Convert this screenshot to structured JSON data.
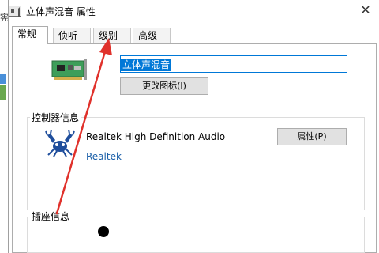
{
  "background": {
    "partial_char": "宪"
  },
  "window": {
    "title": "立体声混音 属性",
    "close_glyph": "✕"
  },
  "tabs": [
    {
      "label": "常规",
      "active": true
    },
    {
      "label": "侦听",
      "active": false
    },
    {
      "label": "级别",
      "active": false
    },
    {
      "label": "高级",
      "active": false
    }
  ],
  "device": {
    "name_value": "立体声混音",
    "change_icon_label": "更改图标(I)",
    "icon": "sound-card-icon"
  },
  "controller": {
    "group_label": "控制器信息",
    "name": "Realtek High Definition Audio",
    "vendor": "Realtek",
    "properties_label": "属性(P)",
    "logo": "realtek-crab-logo"
  },
  "jack": {
    "group_label": "插座信息"
  },
  "annotation": {
    "color": "#e0312b",
    "points_to": "tab-levels"
  }
}
